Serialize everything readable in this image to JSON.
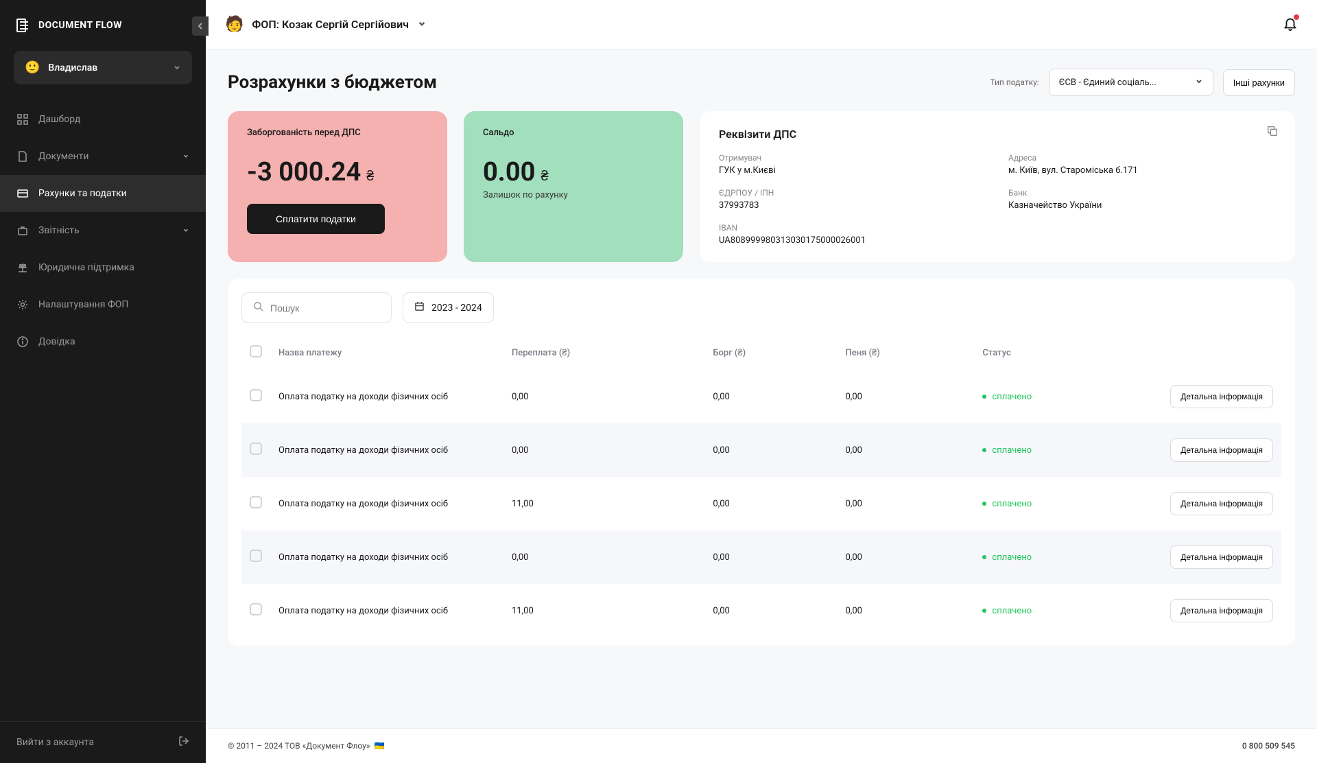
{
  "brand": {
    "name": "DOCUMENT FLOW"
  },
  "user": {
    "avatar": "🙂",
    "name": "Владислав"
  },
  "nav": {
    "items": [
      {
        "label": "Дашборд"
      },
      {
        "label": "Документи"
      },
      {
        "label": "Рахунки та податки"
      },
      {
        "label": "Звітність"
      },
      {
        "label": "Юридична підтримка"
      },
      {
        "label": "Налаштування ФОП"
      },
      {
        "label": "Довідка"
      }
    ],
    "logout": "Вийти з аккаунта"
  },
  "topbar": {
    "entity_avatar": "🧑",
    "entity_prefix": "ФОП:",
    "entity_name": "Козак Сергій Сергійович"
  },
  "page": {
    "title": "Розрахунки з бюджетом",
    "tax_type_label": "Тип податку:",
    "tax_type_selected": "ЄСВ - Єдиний соціаль...",
    "other_accounts": "Інші рахунки"
  },
  "cards": {
    "debt": {
      "label": "Заборгованість перед ДПС",
      "amount": "-3 000.24",
      "currency": "₴",
      "pay_button": "Сплатити податки"
    },
    "balance": {
      "label": "Сальдо",
      "amount": "0.00",
      "currency": "₴",
      "sub": "Залишок по рахунку"
    },
    "details": {
      "title": "Реквізити ДПС",
      "recipient_label": "Отримувач",
      "recipient_value": "ГУК у м.Києві",
      "address_label": "Адреса",
      "address_value": "м. Київ, вул. Староміська б.171",
      "code_label": "ЄДРПОУ / ІПН",
      "code_value": "37993783",
      "bank_label": "Банк",
      "bank_value": "Казначейство України",
      "iban_label": "IBAN",
      "iban_value": "UA808999980313030175000026001"
    }
  },
  "filters": {
    "search_placeholder": "Пошук",
    "date_range": "2023 - 2024"
  },
  "table": {
    "headers": {
      "name": "Назва платежу",
      "overpay": "Переплата (₴)",
      "debt": "Борг (₴)",
      "penalty": "Пеня (₴)",
      "status": "Статус"
    },
    "status_paid": "сплачено",
    "details_button": "Детальна інформація",
    "rows": [
      {
        "name": "Оплата податку на доходи фізичних осіб",
        "overpay": "0,00",
        "debt": "0,00",
        "penalty": "0,00"
      },
      {
        "name": "Оплата податку на доходи фізичних осіб",
        "overpay": "0,00",
        "debt": "0,00",
        "penalty": "0,00"
      },
      {
        "name": "Оплата податку на доходи фізичних осіб",
        "overpay": "11,00",
        "debt": "0,00",
        "penalty": "0,00"
      },
      {
        "name": "Оплата податку на доходи фізичних осіб",
        "overpay": "0,00",
        "debt": "0,00",
        "penalty": "0,00"
      },
      {
        "name": "Оплата податку на доходи фізичних осіб",
        "overpay": "11,00",
        "debt": "0,00",
        "penalty": "0,00"
      }
    ]
  },
  "footer": {
    "copyright": "© 2011 – 2024 ТОВ «Документ Флоу»",
    "flag": "🇺🇦",
    "phone": "0 800 509 545"
  }
}
